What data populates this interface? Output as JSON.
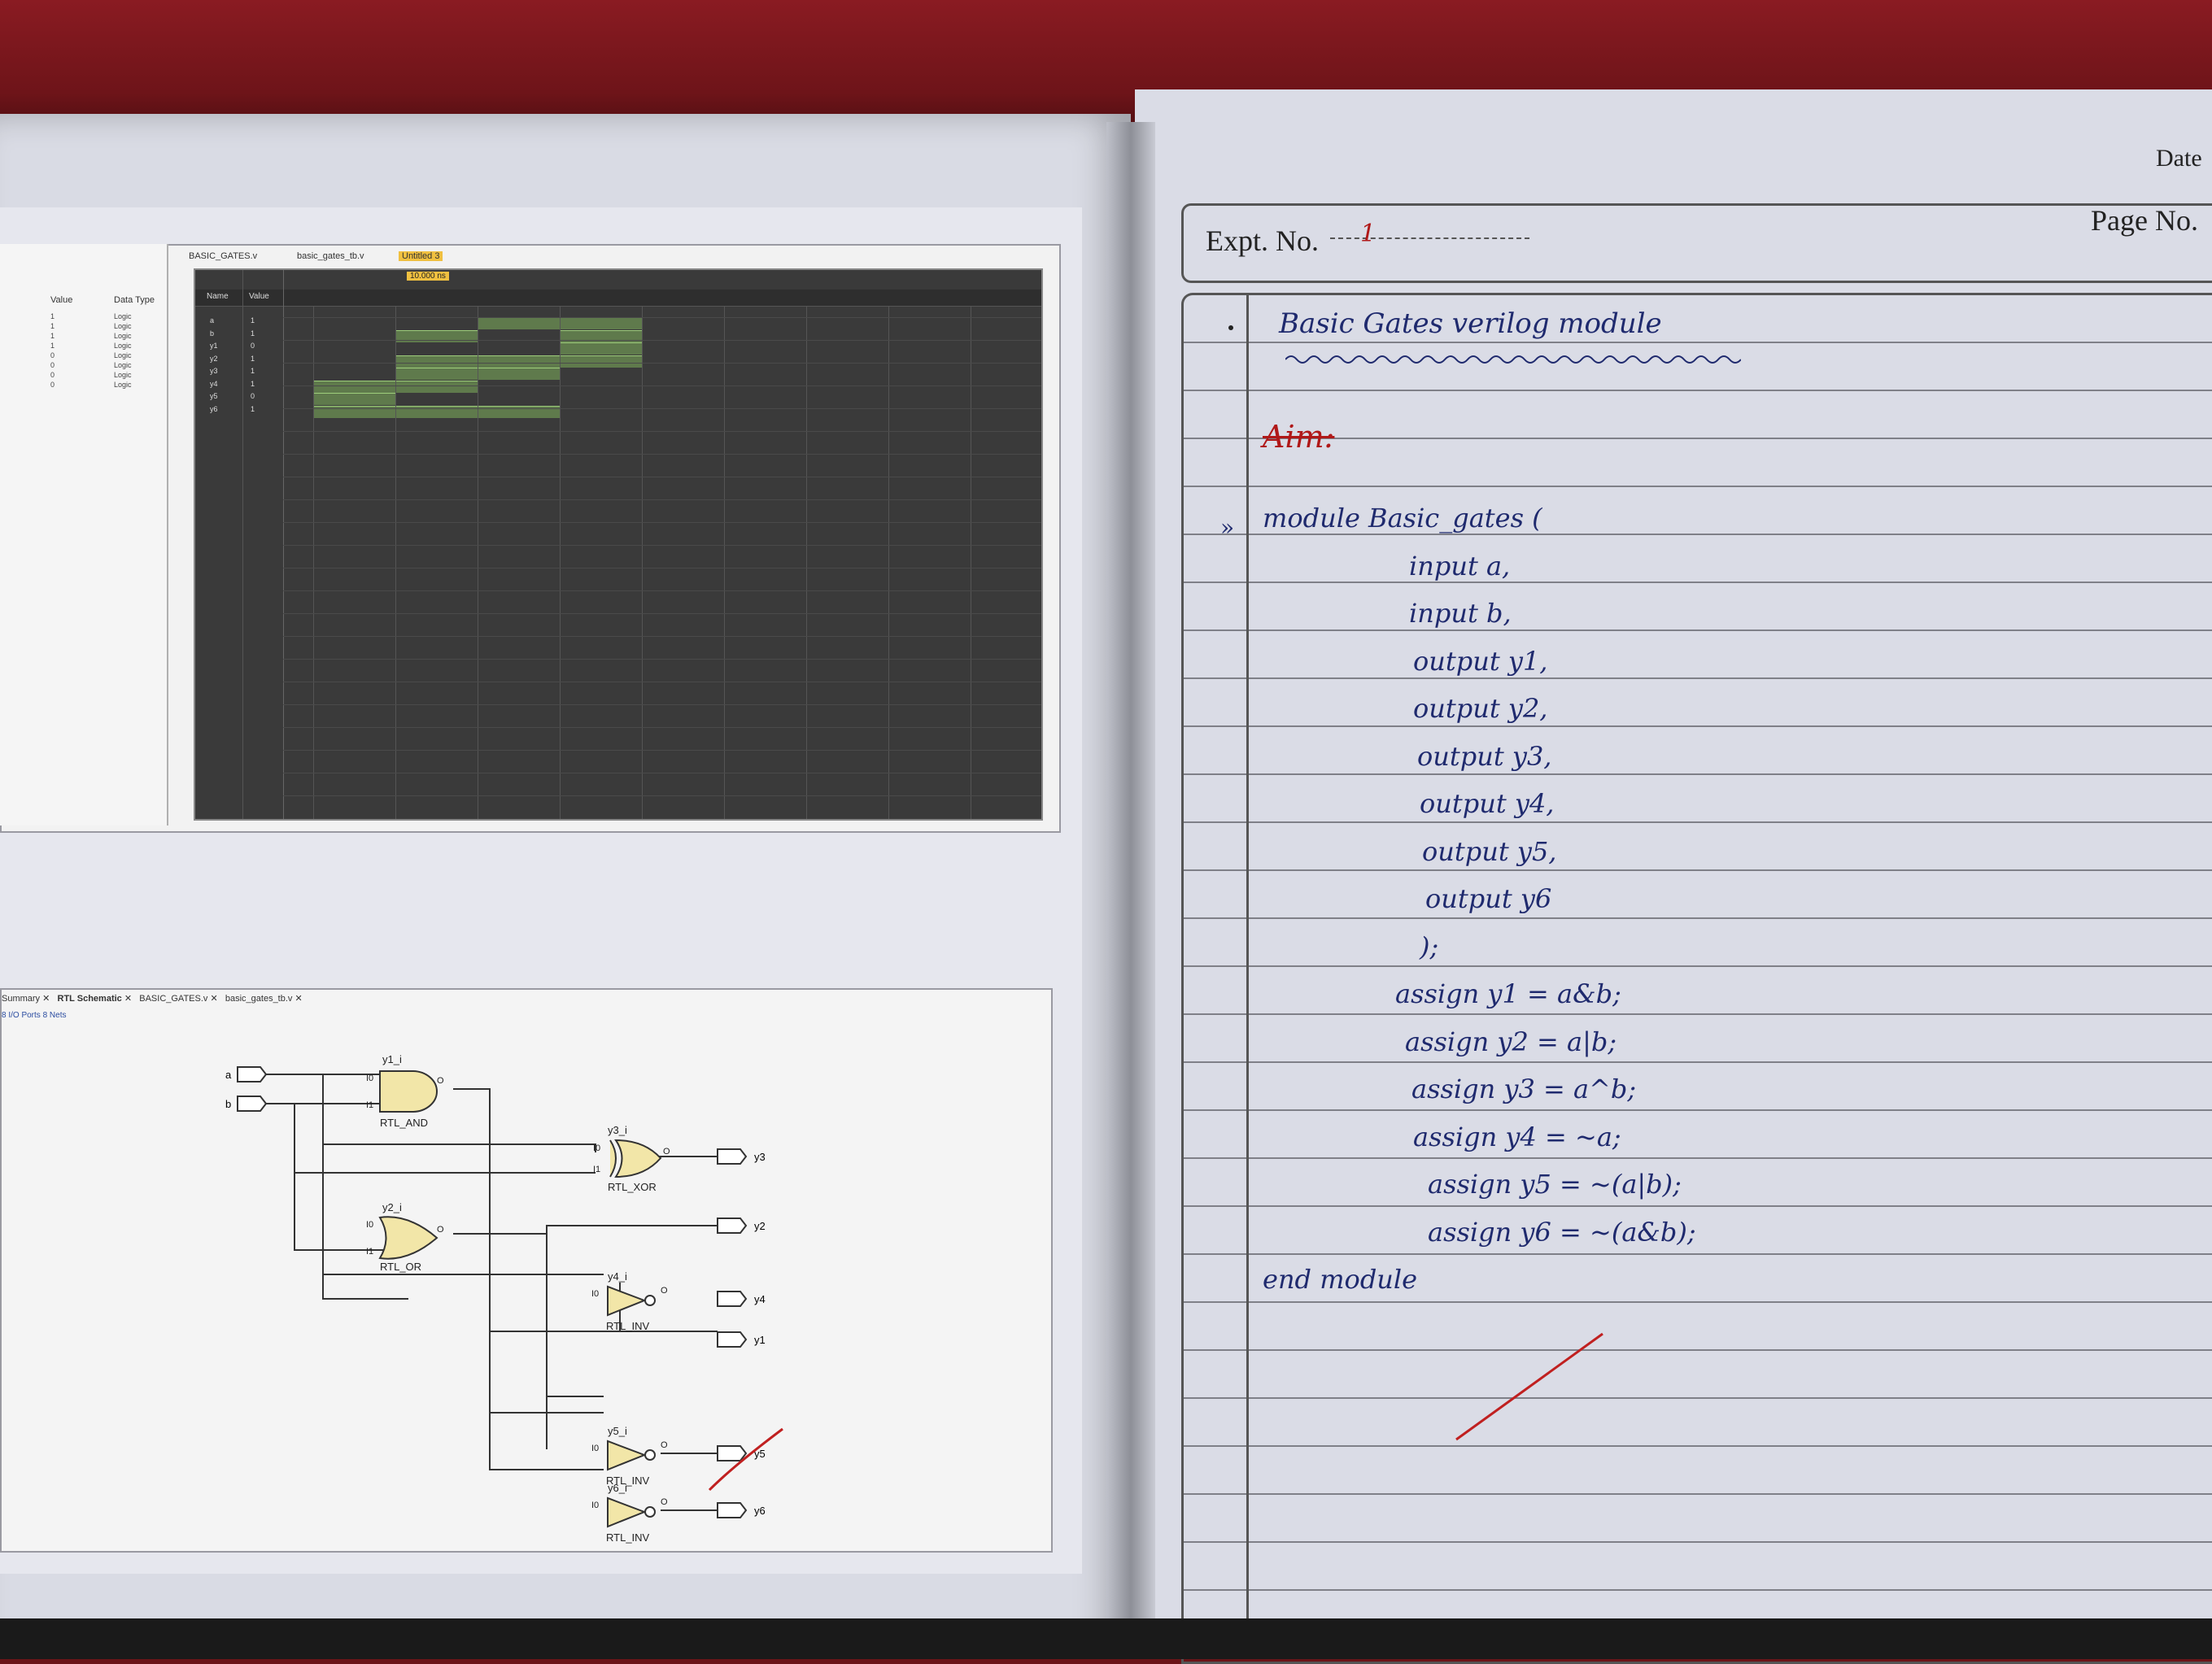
{
  "simulator": {
    "objects_header": {
      "value": "Value",
      "data_type": "Data Type"
    },
    "objects_rows": [
      {
        "value": "1",
        "type": "Logic"
      },
      {
        "value": "1",
        "type": "Logic"
      },
      {
        "value": "1",
        "type": "Logic"
      },
      {
        "value": "1",
        "type": "Logic"
      },
      {
        "value": "0",
        "type": "Logic"
      },
      {
        "value": "0",
        "type": "Logic"
      },
      {
        "value": "0",
        "type": "Logic"
      },
      {
        "value": "0",
        "type": "Logic"
      }
    ],
    "tabs": [
      "BASIC_GATES.v",
      "basic_gates_tb.v",
      "Untitled 3"
    ],
    "cursor_time": "10.000 ns",
    "wave_header": {
      "name": "Name",
      "value": "Value"
    },
    "signals": [
      {
        "name": "a",
        "value": "1"
      },
      {
        "name": "b",
        "value": "1"
      },
      {
        "name": "y1",
        "value": "0"
      },
      {
        "name": "y2",
        "value": "1"
      },
      {
        "name": "y3",
        "value": "1"
      },
      {
        "name": "y4",
        "value": "1"
      },
      {
        "name": "y5",
        "value": "0"
      },
      {
        "name": "y6",
        "value": "1"
      }
    ]
  },
  "schematic": {
    "tabs": [
      "Summary",
      "RTL Schematic",
      "BASIC_GATES.v",
      "basic_gates_tb.v"
    ],
    "sub": "8 I/O Ports   8 Nets",
    "inputs": [
      "a",
      "b"
    ],
    "gates": [
      {
        "inst": "y1_i",
        "type": "RTL_AND"
      },
      {
        "inst": "y2_i",
        "type": "RTL_OR"
      },
      {
        "inst": "y3_i",
        "type": "RTL_XOR"
      },
      {
        "inst": "y4_i",
        "type": "RTL_INV"
      },
      {
        "inst": "y5_i",
        "type": "RTL_INV"
      },
      {
        "inst": "y6_i",
        "type": "RTL_INV"
      }
    ],
    "pin_labels": {
      "i0": "I0",
      "i1": "I1",
      "o": "O"
    },
    "outputs": [
      "y3",
      "y2",
      "y4",
      "y1",
      "y5",
      "y6"
    ]
  },
  "notebook": {
    "date_label": "Date",
    "page_label": "Page No.",
    "expt_label": "Expt. No.",
    "expt_value": "1",
    "title": "Basic Gates verilog module",
    "aim": "Aim:",
    "code_lines": [
      "module Basic_gates (",
      "input a,",
      "input b,",
      "output y1,",
      "output y2,",
      "output y3,",
      "output y4,",
      "output y5,",
      "output y6",
      ");",
      "assign y1 = a&b;",
      "assign y2 = a|b;",
      "assign y3 = a^b;",
      "assign y4 = ~a;",
      "assign y5 = ~(a|b);",
      "assign y6 = ~(a&b);",
      "end module"
    ]
  }
}
